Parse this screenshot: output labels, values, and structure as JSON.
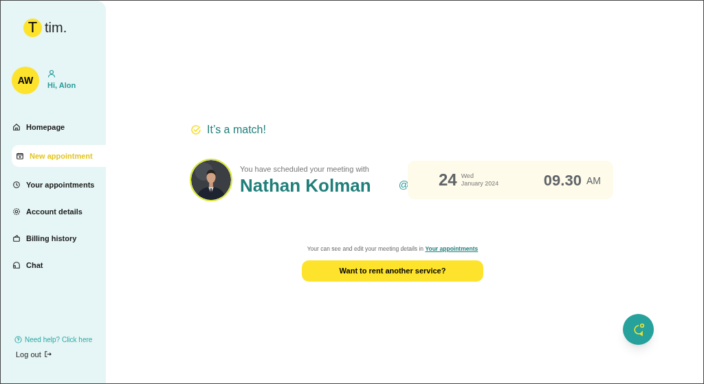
{
  "logo": {
    "letter": "T",
    "text": "tim."
  },
  "user": {
    "initials": "AW",
    "greeting": "Hi, Alon"
  },
  "nav": [
    {
      "label": "Homepage",
      "kind": "home",
      "selected": false
    },
    {
      "label": "New appointment",
      "kind": "calendar",
      "selected": true
    },
    {
      "label": "Your appointments",
      "kind": "clock",
      "selected": false
    },
    {
      "label": "Account details",
      "kind": "gear",
      "selected": false
    },
    {
      "label": "Billing history",
      "kind": "bag",
      "selected": false
    },
    {
      "label": "Chat",
      "kind": "chat",
      "selected": false
    }
  ],
  "help": "Need help? Click here",
  "logout": "Log out",
  "match": {
    "title": "It’s a match!",
    "intro": "You have scheduled your meeting with",
    "name": "Nathan Kolman",
    "at": "@",
    "day": "24",
    "weekday": "Wed",
    "month": "January 2024",
    "time": "09.30",
    "meridiem": "AM"
  },
  "note": {
    "text": "Your can see and edit your meeting details in",
    "link": "Your appointments"
  },
  "cta": "Want to rent another service?"
}
